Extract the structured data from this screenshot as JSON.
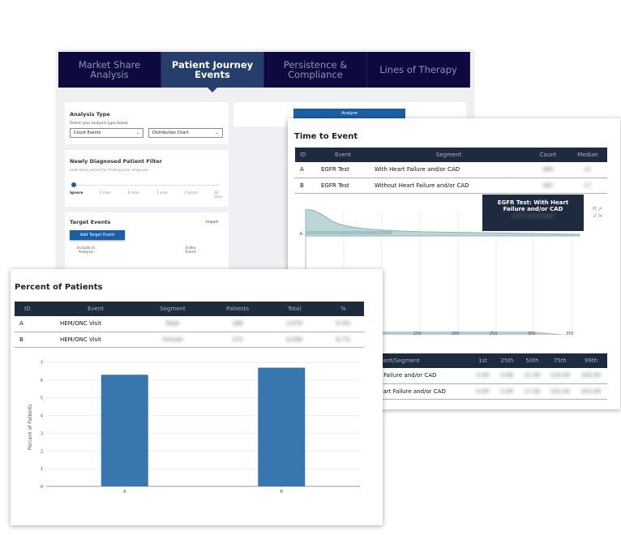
{
  "tabs": [
    {
      "label": "Market Share Analysis",
      "active": false
    },
    {
      "label": "Patient Journey Events",
      "active": true
    },
    {
      "label": "Persistence & Compliance",
      "active": false
    },
    {
      "label": "Lines of Therapy",
      "active": false
    }
  ],
  "analysis_type": {
    "title": "Analysis Type",
    "hint": "Select your analysis type below",
    "select1": "Count Events",
    "select2": "Distribution Chart"
  },
  "filter": {
    "title": "Newly Diagnosed Patient Filter",
    "hint": "Look back period for finding prior diagnosis",
    "stops": [
      "Ignore",
      "3 mos.",
      "6 mos.",
      "1 year",
      "2 years",
      "All-time"
    ],
    "selected": "Ignore"
  },
  "target_events": {
    "title": "Target Events",
    "import": "Import",
    "add_button": "Add Target Event",
    "col1": "Include in Analysis",
    "col2": "Index Event"
  },
  "analyze_button": "Analyze",
  "time_to_event": {
    "title": "Time to Event",
    "headers": [
      "ID",
      "Event",
      "Segment",
      "Count",
      "Median"
    ],
    "rows": [
      [
        "A",
        "EGFR Test",
        "With Heart Failure and/or CAD",
        "485",
        "21"
      ],
      [
        "B",
        "EGFR Test",
        "Without Heart Failure and/or CAD",
        "587",
        "17"
      ]
    ],
    "tooltip": {
      "title": "EGFR Test: With Heart Failure and/or CAD",
      "value": "0.07% at 314 days"
    },
    "axis_label_a": "A",
    "x_ticks": [
      "150",
      "200",
      "250",
      "300",
      "350"
    ],
    "pct_headers": [
      "Event/Segment",
      "1st",
      "25th",
      "50th",
      "75th",
      "99th"
    ],
    "pct_rows": [
      [
        "EGFR Test: With Heart Failure and/or CAD",
        "0.00",
        "0.00",
        "21.00",
        "120.00",
        "320.00"
      ],
      [
        "EGFR Test: Without Heart Failure and/or CAD",
        "0.00",
        "0.00",
        "17.00",
        "152.00",
        "315.00"
      ]
    ]
  },
  "percent": {
    "title": "Percent of Patients",
    "headers": [
      "ID",
      "Event",
      "Segment",
      "Patients",
      "Total",
      "%"
    ],
    "rows": [
      [
        "A",
        "HEM/ONC Visit",
        "Male",
        "186",
        "2,974",
        "6.3%"
      ],
      [
        "B",
        "HEM/ONC Visit",
        "Female",
        "272",
        "4,058",
        "6.7%"
      ]
    ]
  },
  "chart_data": {
    "type": "bar",
    "categories": [
      "A",
      "B"
    ],
    "values": [
      6.3,
      6.7
    ],
    "ylabel": "Percent of Patients",
    "xlabel": "",
    "ylim": [
      0,
      7
    ],
    "yticks": [
      0,
      1,
      2,
      3,
      4,
      5,
      6,
      7
    ],
    "grid": true,
    "color": "#3876b0"
  }
}
